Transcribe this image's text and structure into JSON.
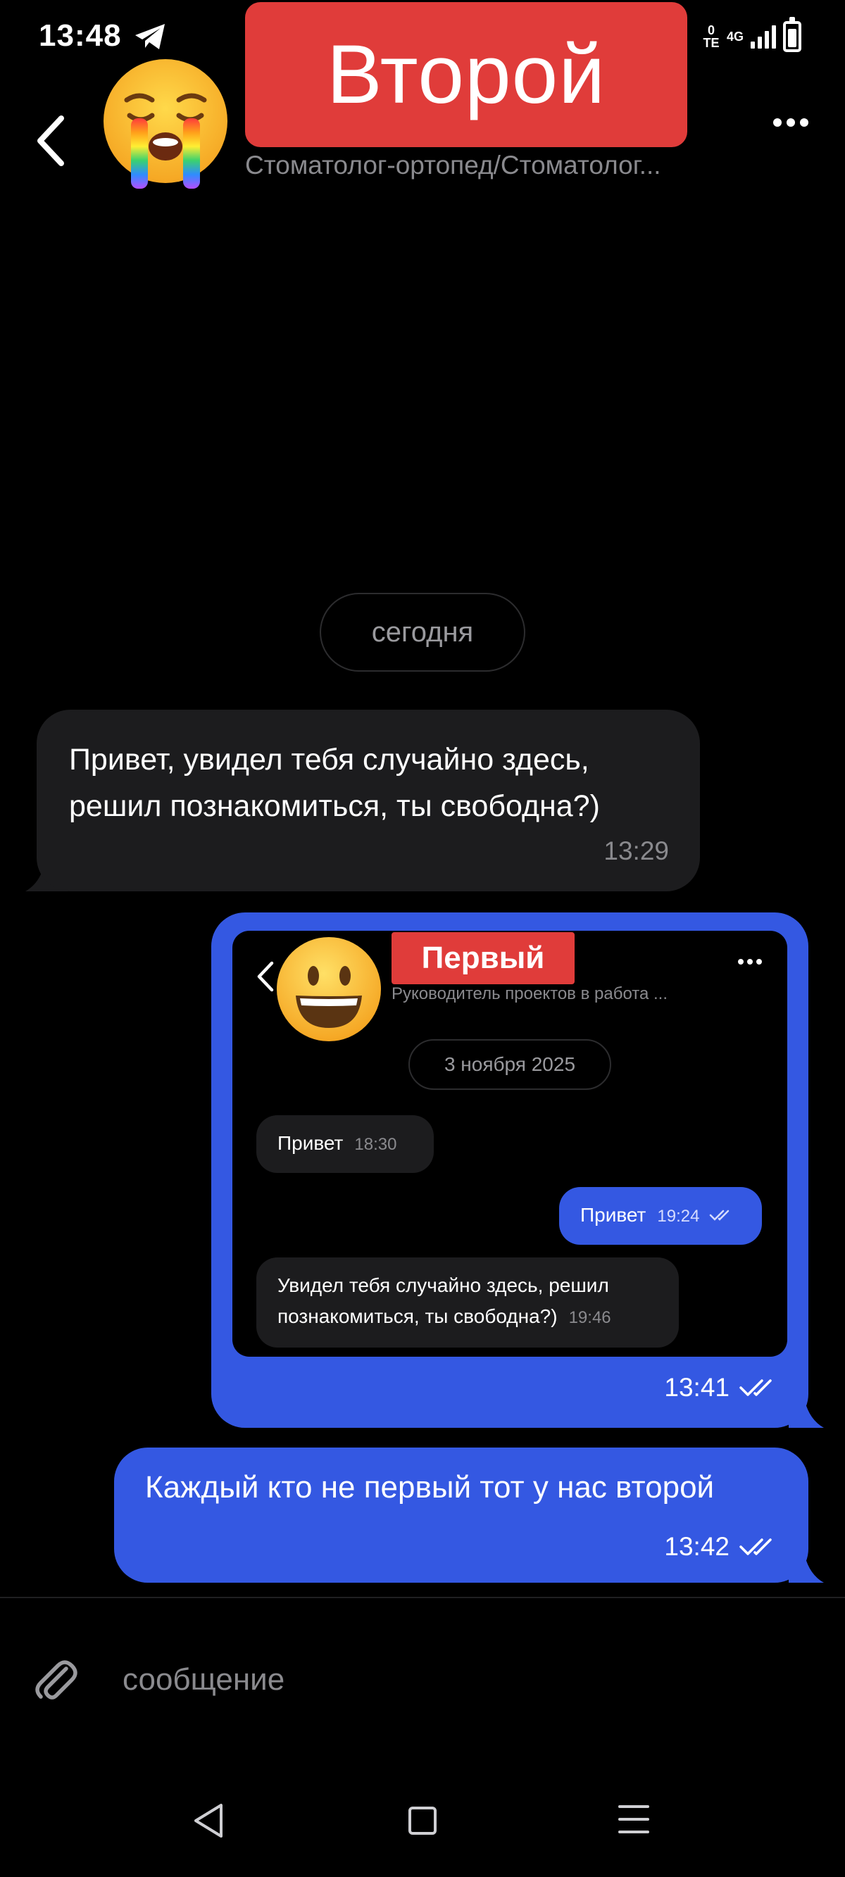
{
  "status_bar": {
    "time": "13:48",
    "lte": "0\nTE",
    "network": "4G"
  },
  "header": {
    "title": "Второй",
    "subtitle": "Стоматолог-ортопед/Стоматолог...",
    "avatar_emoji": "loudly-crying-face"
  },
  "chat": {
    "date_separator": "сегодня",
    "messages": [
      {
        "direction": "in",
        "text": "Привет, увидел тебя случайно здесь, решил познакомиться, ты свободна?)",
        "time": "13:29"
      },
      {
        "direction": "out",
        "type": "screenshot",
        "time": "13:41",
        "status": "read"
      },
      {
        "direction": "out",
        "text": "Каждый кто не первый тот у нас второй",
        "time": "13:42",
        "status": "read"
      }
    ]
  },
  "screenshot": {
    "title": "Первый",
    "subtitle": "Руководитель проектов в работа ...",
    "date_separator": "3 ноября 2025",
    "messages": [
      {
        "direction": "in",
        "text": "Привет",
        "time": "18:30"
      },
      {
        "direction": "out",
        "text": "Привет",
        "time": "19:24"
      },
      {
        "direction": "in",
        "text_line1": "Увидел тебя случайно здесь, решил",
        "text_line2": "познакомиться, ты свободна?)",
        "time": "19:46"
      }
    ]
  },
  "composer": {
    "placeholder": "сообщение"
  },
  "colors": {
    "accent": "#3458e2",
    "incoming_bubble": "#1c1c1e",
    "banner": "#e03c3a",
    "background": "#000000"
  }
}
